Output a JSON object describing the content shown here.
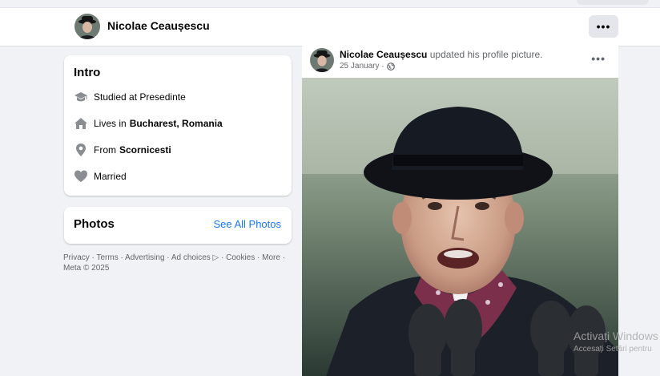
{
  "profile": {
    "name": "Nicolae Ceaușescu",
    "more_label": "•••"
  },
  "intro": {
    "title": "Intro",
    "items": [
      {
        "icon": "graduation-cap-icon",
        "prefix": "Studied at Presedinte",
        "bold": ""
      },
      {
        "icon": "home-icon",
        "prefix": "Lives in",
        "bold": "Bucharest, Romania"
      },
      {
        "icon": "location-pin-icon",
        "prefix": "From",
        "bold": "Scornicesti"
      },
      {
        "icon": "heart-icon",
        "prefix": "Married",
        "bold": ""
      }
    ]
  },
  "photos": {
    "title": "Photos",
    "see_all": "See All Photos"
  },
  "footer": {
    "line1": "Privacy · Terms · Advertising · Ad choices ▷ · Cookies · More ·",
    "line2": "Meta © 2025"
  },
  "post": {
    "author": "Nicolae Ceaușescu",
    "action": "updated his profile picture.",
    "date": "25 January ·",
    "audience_icon": "globe-icon",
    "more_label": "•••"
  },
  "watermark": {
    "line1": "Activați Windows",
    "line2": "Accesați Setări pentru"
  }
}
